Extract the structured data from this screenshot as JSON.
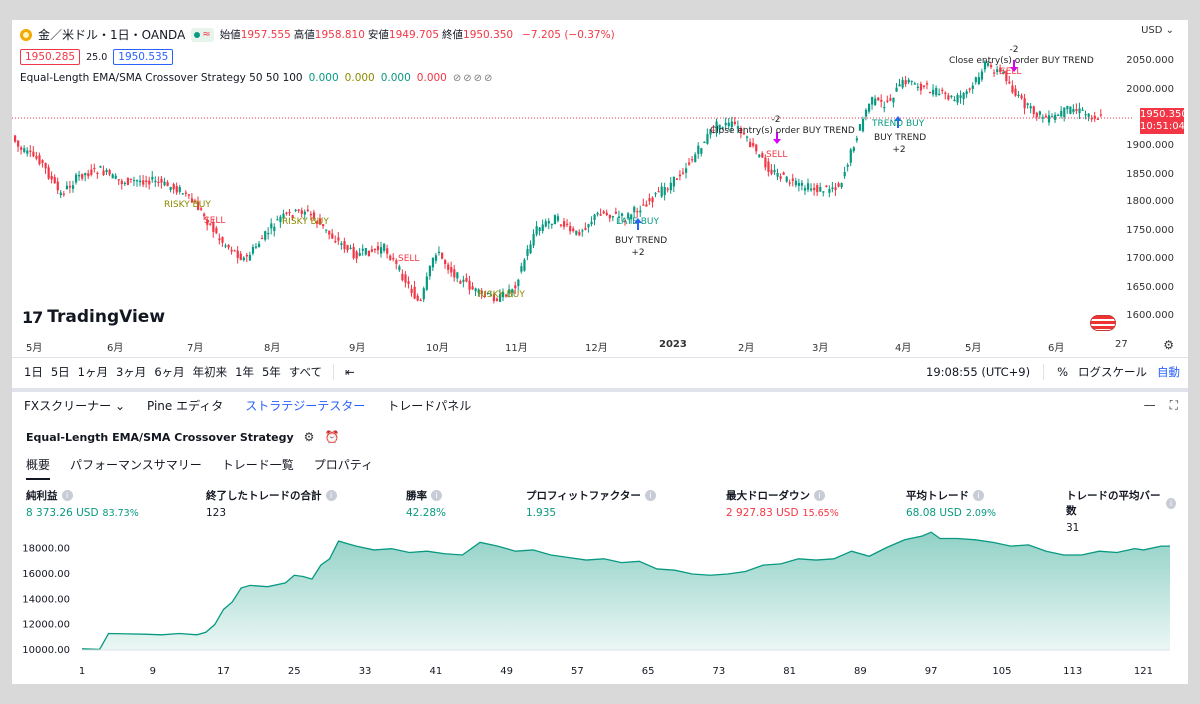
{
  "header": {
    "symbol": "金／米ドル・1日・OANDA",
    "ohlc": [
      {
        "k": "始値",
        "v": "1957.555"
      },
      {
        "k": "高値",
        "v": "1958.810"
      },
      {
        "k": "安値",
        "v": "1949.705"
      },
      {
        "k": "終値",
        "v": "1950.350"
      }
    ],
    "change": "−7.205 (−0.37%)",
    "sell_price": "1950.285",
    "spread": "25.0",
    "buy_price": "1950.535",
    "strategy_line": "Equal-Length EMA/SMA Crossover Strategy 50 50 100",
    "strategy_values": [
      "0.000",
      "0.000",
      "0.000",
      "0.000"
    ]
  },
  "price_scale": {
    "currency": "USD",
    "labels": [
      "2050.000",
      "2000.000",
      "1900.000",
      "1850.000",
      "1800.000",
      "1750.000",
      "1700.000",
      "1650.000",
      "1600.000"
    ],
    "last_price": "1950.350",
    "countdown": "10:51:04"
  },
  "time_axis": [
    "5月",
    "6月",
    "7月",
    "8月",
    "9月",
    "10月",
    "11月",
    "12月",
    "2023",
    "2月",
    "3月",
    "4月",
    "5月",
    "6月",
    "27"
  ],
  "annotations": {
    "risky_buy": "RISKY BUY",
    "sell": "SELL",
    "late_buy": "LATE BUY",
    "trend_buy": "TREND BUY",
    "buy_trend": "BUY TREND",
    "plus2": "+2",
    "minus2": "-2",
    "close_entry": "Close entry(s) order BUY TREND"
  },
  "brand": "TradingView",
  "timeframes": [
    "1日",
    "5日",
    "1ヶ月",
    "3ヶ月",
    "6ヶ月",
    "年初来",
    "1年",
    "5年",
    "すべて"
  ],
  "tf_right": {
    "clock": "19:08:55 (UTC+9)",
    "percent": "%",
    "log": "ログスケール",
    "auto": "自動"
  },
  "panel": {
    "tabs": [
      "FXスクリーナー",
      "Pine エディタ",
      "ストラテジーテスター",
      "トレードパネル"
    ],
    "active_tab": 2,
    "strategy_title": "Equal-Length EMA/SMA Crossover Strategy",
    "sub_tabs": [
      "概要",
      "パフォーマンスサマリー",
      "トレード一覧",
      "プロパティ"
    ]
  },
  "stats": [
    {
      "label": "純利益",
      "value": "8 373.26 USD",
      "pct": "83.73%",
      "color": "#089981"
    },
    {
      "label": "終了したトレードの合計",
      "value": "123",
      "pct": "",
      "color": "#131722"
    },
    {
      "label": "勝率",
      "value": "42.28%",
      "pct": "",
      "color": "#089981"
    },
    {
      "label": "プロフィットファクター",
      "value": "1.935",
      "pct": "",
      "color": "#089981"
    },
    {
      "label": "最大ドローダウン",
      "value": "2 927.83 USD",
      "pct": "15.65%",
      "color": "#f23645"
    },
    {
      "label": "平均トレード",
      "value": "68.08 USD",
      "pct": "2.09%",
      "color": "#089981"
    },
    {
      "label": "トレードの平均バー数",
      "value": "31",
      "pct": "",
      "color": "#131722"
    }
  ],
  "chart_data": {
    "type": "area",
    "title": "",
    "xlabel": "",
    "ylabel": "",
    "x_ticks": [
      1,
      9,
      17,
      25,
      33,
      41,
      49,
      57,
      65,
      73,
      81,
      89,
      97,
      105,
      113,
      121
    ],
    "y_ticks": [
      10000,
      12000,
      14000,
      16000,
      18000
    ],
    "ylim": [
      10000,
      19000
    ],
    "xlim": [
      1,
      124
    ],
    "color": "#089981",
    "values": [
      [
        1,
        10100
      ],
      [
        3,
        10050
      ],
      [
        4,
        11300
      ],
      [
        8,
        11250
      ],
      [
        10,
        11200
      ],
      [
        12,
        11300
      ],
      [
        14,
        11200
      ],
      [
        15,
        11400
      ],
      [
        16,
        12000
      ],
      [
        17,
        13200
      ],
      [
        18,
        13800
      ],
      [
        19,
        14900
      ],
      [
        20,
        15100
      ],
      [
        22,
        15000
      ],
      [
        24,
        15300
      ],
      [
        25,
        15900
      ],
      [
        26,
        15800
      ],
      [
        27,
        15600
      ],
      [
        28,
        16700
      ],
      [
        29,
        17200
      ],
      [
        30,
        18600
      ],
      [
        31,
        18400
      ],
      [
        32,
        18200
      ],
      [
        34,
        17900
      ],
      [
        36,
        18000
      ],
      [
        38,
        17700
      ],
      [
        40,
        17800
      ],
      [
        42,
        17600
      ],
      [
        44,
        17500
      ],
      [
        46,
        18500
      ],
      [
        48,
        18200
      ],
      [
        50,
        17800
      ],
      [
        52,
        17900
      ],
      [
        54,
        17500
      ],
      [
        56,
        17300
      ],
      [
        58,
        17100
      ],
      [
        60,
        17200
      ],
      [
        62,
        16900
      ],
      [
        64,
        17000
      ],
      [
        66,
        16400
      ],
      [
        68,
        16300
      ],
      [
        70,
        16000
      ],
      [
        72,
        15900
      ],
      [
        74,
        16000
      ],
      [
        76,
        16200
      ],
      [
        78,
        16700
      ],
      [
        80,
        16800
      ],
      [
        82,
        17200
      ],
      [
        84,
        17100
      ],
      [
        86,
        17200
      ],
      [
        88,
        17800
      ],
      [
        90,
        17400
      ],
      [
        92,
        18100
      ],
      [
        94,
        18700
      ],
      [
        96,
        19000
      ],
      [
        97,
        19300
      ],
      [
        98,
        18800
      ],
      [
        100,
        18800
      ],
      [
        102,
        18700
      ],
      [
        104,
        18500
      ],
      [
        106,
        18200
      ],
      [
        108,
        18300
      ],
      [
        110,
        17800
      ],
      [
        112,
        17500
      ],
      [
        114,
        17500
      ],
      [
        116,
        17800
      ],
      [
        118,
        17700
      ],
      [
        120,
        18000
      ],
      [
        121,
        17900
      ],
      [
        123,
        18200
      ],
      [
        124,
        18200
      ]
    ]
  }
}
